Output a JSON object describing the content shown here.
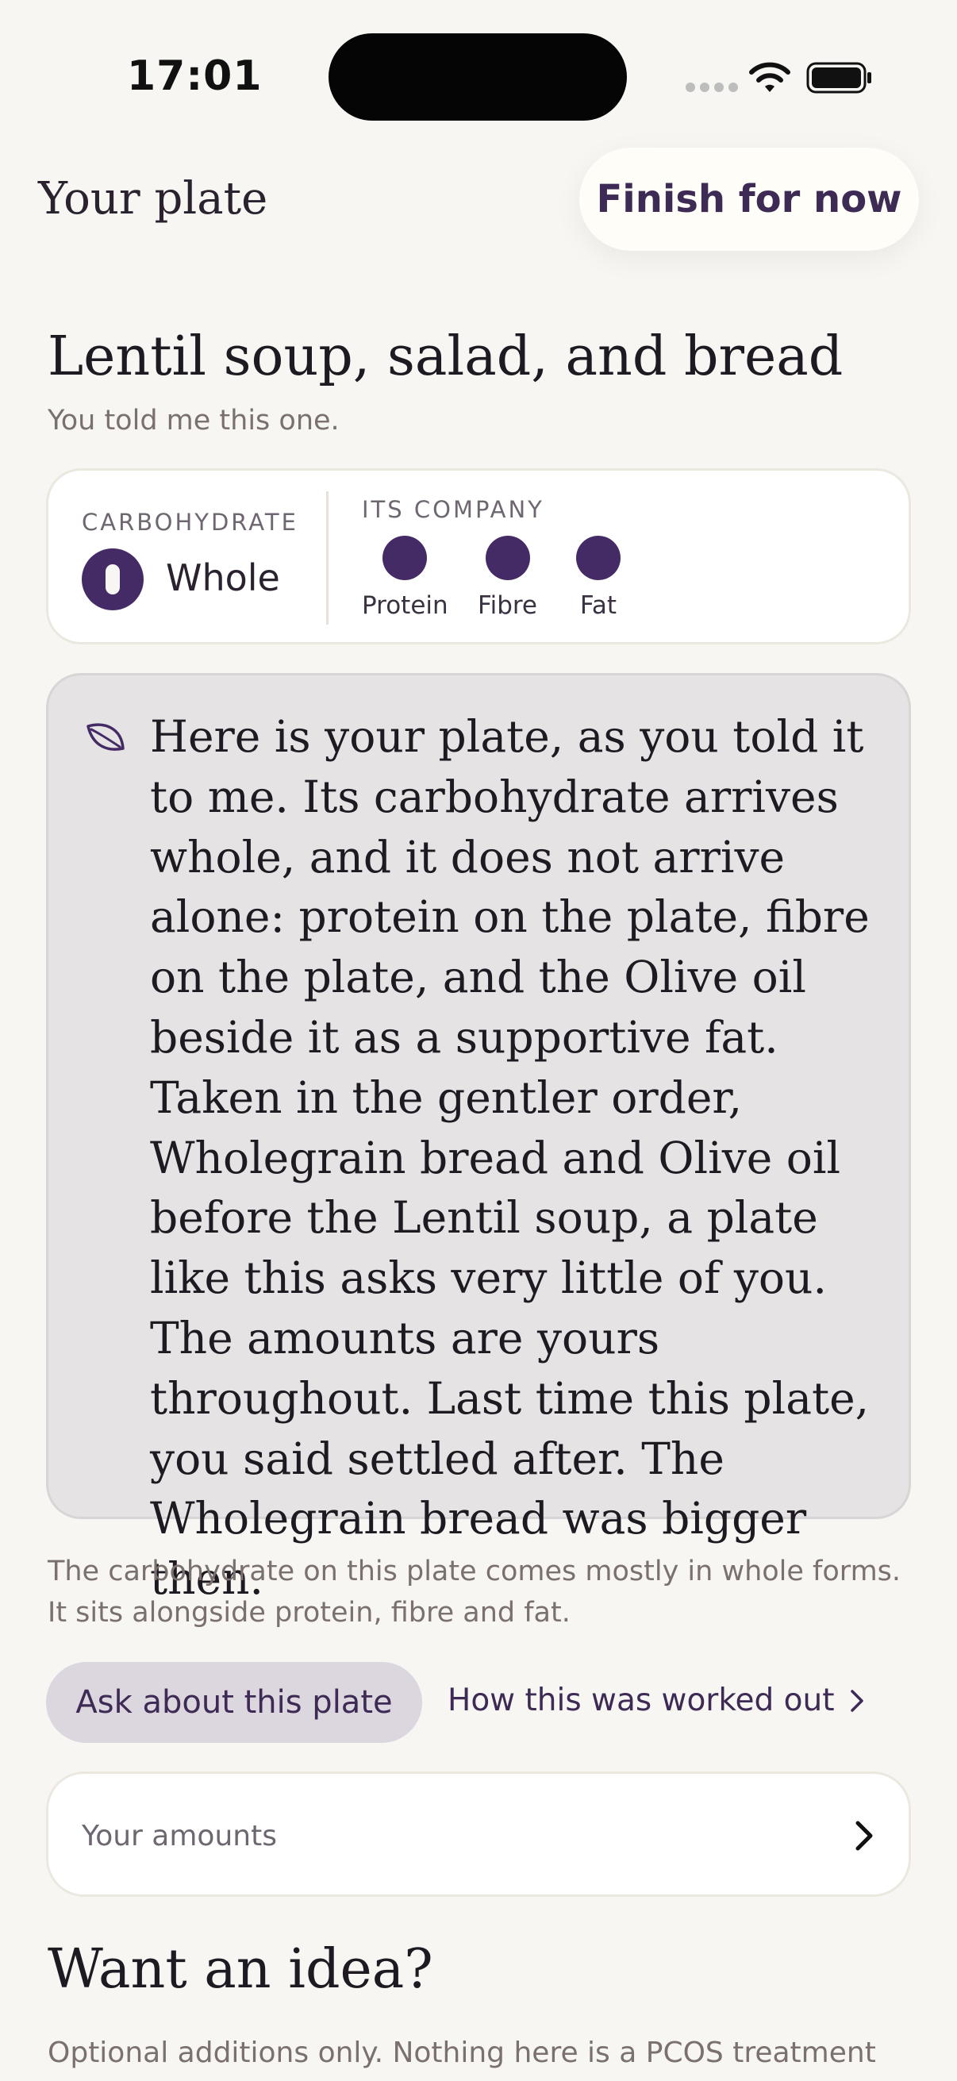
{
  "status_bar": {
    "time": "17:01"
  },
  "header": {
    "title": "Your plate",
    "finish_label": "Finish for now"
  },
  "meal": {
    "title": "Lentil soup, salad, and bread",
    "subtitle": "You told me this one."
  },
  "summary": {
    "carb_label": "CARBOHYDRATE",
    "carb_value": "Whole",
    "company_label": "ITS COMPANY",
    "company": [
      {
        "label": "Protein"
      },
      {
        "label": "Fibre"
      },
      {
        "label": "Fat"
      }
    ]
  },
  "story": {
    "text": "Here is your plate, as you told it to me. Its carbohydrate arrives whole, and it does not arrive alone: protein on the plate, fibre on the plate, and the Olive oil beside it as a supportive fat. Taken in the gentler order, Wholegrain bread and Olive oil before the Lentil soup, a plate like this asks very little of you. The amounts are yours throughout. Last time this plate, you said settled after. The Wholegrain bread was bigger then."
  },
  "explanation": {
    "line1": "The carbohydrate on this plate comes mostly in whole forms.",
    "line2": "It sits alongside protein, fibre and fat."
  },
  "actions": {
    "ask_label": "Ask about this plate",
    "how_label": "How this was worked out"
  },
  "amounts": {
    "label": "Your amounts"
  },
  "idea": {
    "title": "Want an idea?",
    "subtitle": "Optional additions only. Nothing here is a PCOS treatment"
  },
  "colors": {
    "accent": "#452b66",
    "background": "#f7f6f2",
    "story_background": "#e6e3e4"
  }
}
